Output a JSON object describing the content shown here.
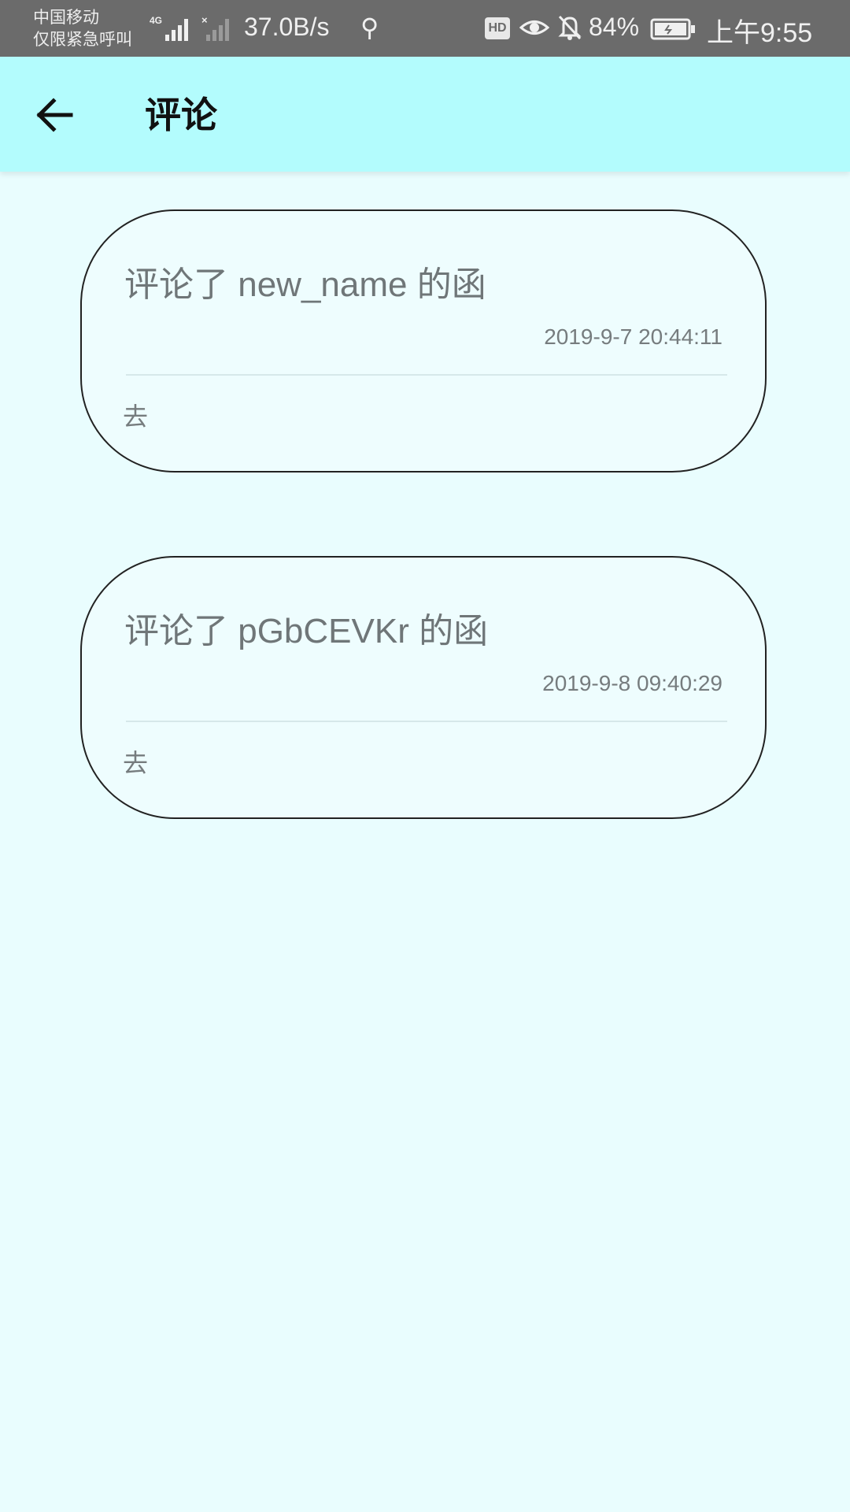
{
  "status_bar": {
    "carrier_line1": "中国移动",
    "carrier_line2": "仅限紧急呼叫",
    "network_type": "4G",
    "net_speed": "37.0B/s",
    "battery_percent": "84%",
    "time": "上午9:55",
    "hd_badge": "HD",
    "icons": [
      "signal-icon",
      "no-signal-icon",
      "usb-icon",
      "hd-icon",
      "eye-icon",
      "bell-off-icon",
      "battery-icon"
    ]
  },
  "app_bar": {
    "title": "评论",
    "back_icon": "arrow-left-icon",
    "background": "#b3fcfd"
  },
  "comments": [
    {
      "title": "评论了 new_name 的函",
      "time": "2019-9-7 20:44:11",
      "action": "去"
    },
    {
      "title": "评论了 pGbCEVKr 的函",
      "time": "2019-9-8 09:40:29",
      "action": "去"
    }
  ],
  "colors": {
    "page_background": "#e9fdfe",
    "status_bar": "#6b6b6b",
    "card_border": "#222222",
    "text_muted": "#6f7678"
  }
}
